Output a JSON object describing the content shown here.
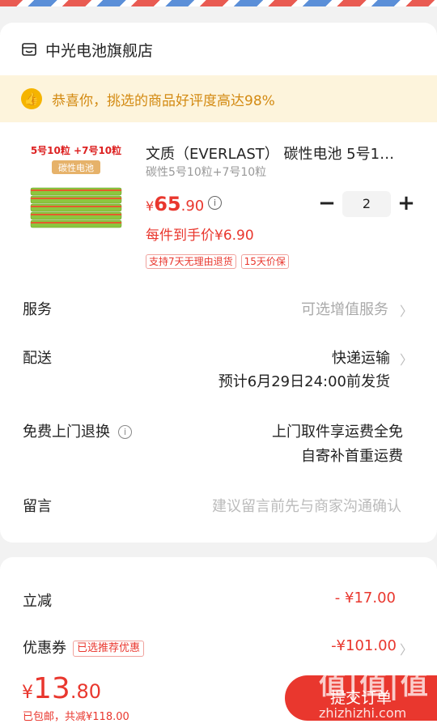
{
  "shop": {
    "icon": "shop-icon",
    "name": "中光电池旗舰店"
  },
  "banner": {
    "icon": "thumbs-up-icon",
    "text": "恭喜你，挑选的商品好评度高达98%"
  },
  "product": {
    "image_caption_top": "5号10粒 +7号10粒",
    "image_caption_badge": "碳性电池",
    "title": "文质（EVERLAST） 碳性电池 5号1…",
    "spec": "碳性5号10粒+7号10粒",
    "price_symbol": "¥",
    "price_int": "65",
    "price_dec": ".90",
    "quantity": "2",
    "per_item_price": "每件到手价¥6.90",
    "tags": [
      "支持7天无理由退货",
      "15天价保"
    ]
  },
  "rows": {
    "service_label": "服务",
    "service_value": "可选增值服务",
    "delivery_label": "配送",
    "delivery_value": "快递运输",
    "delivery_eta": "预计6月29日24:00前发货",
    "return_label": "免费上门退换",
    "return_value_1": "上门取件享运费全免",
    "return_value_2": "自寄补首重运费",
    "note_label": "留言",
    "note_placeholder": "建议留言前先与商家沟通确认"
  },
  "discounts": {
    "instant_label": "立减",
    "instant_value": "- ¥17.00",
    "coupon_label": "优惠券",
    "coupon_tag": "已选推荐优惠",
    "coupon_value": "-¥101.00"
  },
  "footer": {
    "total_symbol": "¥",
    "total_int": "13",
    "total_dec": ".80",
    "sub_total": "已包邮，共减¥118.00",
    "submit_label": "提交订单"
  },
  "watermark": {
    "text": "值|值|值",
    "url": "zhizhizhi.com"
  },
  "colors": {
    "accent": "#e9372e",
    "banner_bg": "#fdf4dc",
    "banner_text": "#d38a12"
  }
}
